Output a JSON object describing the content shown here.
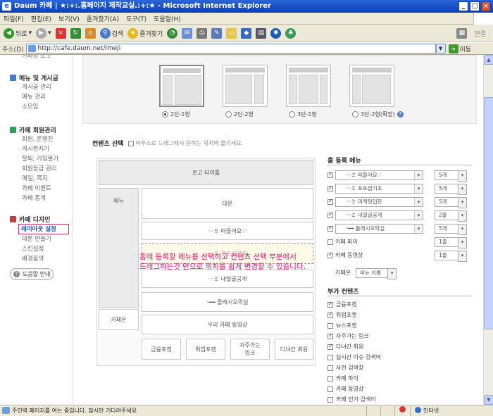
{
  "window": {
    "title": "Daum 카페 | ★:+:.홈페이지 제작교실.:+:★ - Microsoft Internet Explorer"
  },
  "menu": [
    "파일(F)",
    "편집(E)",
    "보기(V)",
    "즐겨찾기(A)",
    "도구(T)",
    "도움말(H)"
  ],
  "toolbar": {
    "back": "뒤로",
    "search": "검색",
    "favorites": "즐겨찾기",
    "connect": "연결"
  },
  "address": {
    "label": "주소(D)",
    "url": "http://cafe.daum.net/imeji",
    "go": "이동"
  },
  "sidebar": {
    "top_partial": "카페명 로고",
    "sec1": {
      "title": "메뉴 및 게시글",
      "items": [
        "게시글 관리",
        "메뉴 관리",
        "소모임"
      ]
    },
    "sec2": {
      "title": "카페 회원관리",
      "items": [
        "회원, 운영진",
        "게시판지기",
        "탈퇴, 가입불가",
        "회원등급 관리",
        "메일, 쪽지",
        "카페 이벤트",
        "카페 통계"
      ]
    },
    "sec3": {
      "title": "카페 디자인",
      "items": [
        "레이아웃 설정",
        "대문 만들기",
        "스킨설정",
        "배경음악"
      ]
    },
    "help": "도움말 안내"
  },
  "layouts": [
    "2단-1형",
    "2단-2형",
    "3단-1형",
    "3단-2형(확장)"
  ],
  "content_select": {
    "title": "컨텐츠 선택",
    "note": "마우스로 드래그해서 원하는 위치에 옮기세요."
  },
  "canvas": {
    "logo": "로고 타이틀",
    "menu": "메뉴",
    "main": "대문",
    "b1": "···ミ 떠들어요♡",
    "b2": "···ミ 포토샵기초",
    "ghost_small": "···ミ 포토샵기초",
    "b3": "···ミ 내얼굴공개",
    "b4": "·━━ 플래시오락실",
    "cafeon": "카페온",
    "b5": "우리 카페 동영상",
    "f1": "금융포켓",
    "f2": "취업포켓",
    "f3a": "자주가는",
    "f3b": "링크",
    "f4": "다녀간 회원"
  },
  "home_menu": {
    "title": "홈 등록 메뉴",
    "rows": [
      {
        "label": "···ミ 떠들어요♡",
        "count": "5개"
      },
      {
        "label": "···ミ 포토샵기초",
        "count": "5개"
      },
      {
        "label": "···ミ 마케팅입문",
        "count": "5개"
      },
      {
        "label": "···ミ 내얼굴공개",
        "count": "2줄"
      },
      {
        "label": "·━━ 플래시오락실",
        "count": "5개"
      }
    ],
    "cafe_pie": "카페 파이",
    "cafe_pie_count": "1줄",
    "cafe_video": "카페 동영상",
    "cafe_video_count": "1줄",
    "cafeon": "카페온",
    "cafeon_opt": "바뉴 이름"
  },
  "extra": {
    "title": "부가 컨텐츠",
    "items": [
      {
        "label": "금융포켓",
        "checked": true
      },
      {
        "label": "취업포켓",
        "checked": true
      },
      {
        "label": "뉴스포켓",
        "checked": false
      },
      {
        "label": "자주가는 링크",
        "checked": true
      },
      {
        "label": "다녀간 회원",
        "checked": true
      },
      {
        "label": "실시간 이슈 검색어",
        "checked": false
      },
      {
        "label": "사전 검색창",
        "checked": false
      },
      {
        "label": "카페 파이",
        "checked": false
      },
      {
        "label": "카페 동영상",
        "checked": false
      },
      {
        "label": "카페 인기 검색어",
        "checked": false
      }
    ]
  },
  "overlay": {
    "line1": "홈에 등록할 메뉴를 선택하고 컨텐츠 선택 부분에서",
    "line2": "드레그하는것 만으로 위치를 쉽게 변경할 수 있습니다."
  },
  "status": {
    "msg": "주인벽 페이지를 여는 중입니다. 잠시만 기다려주세요",
    "zone": "인터넷"
  }
}
